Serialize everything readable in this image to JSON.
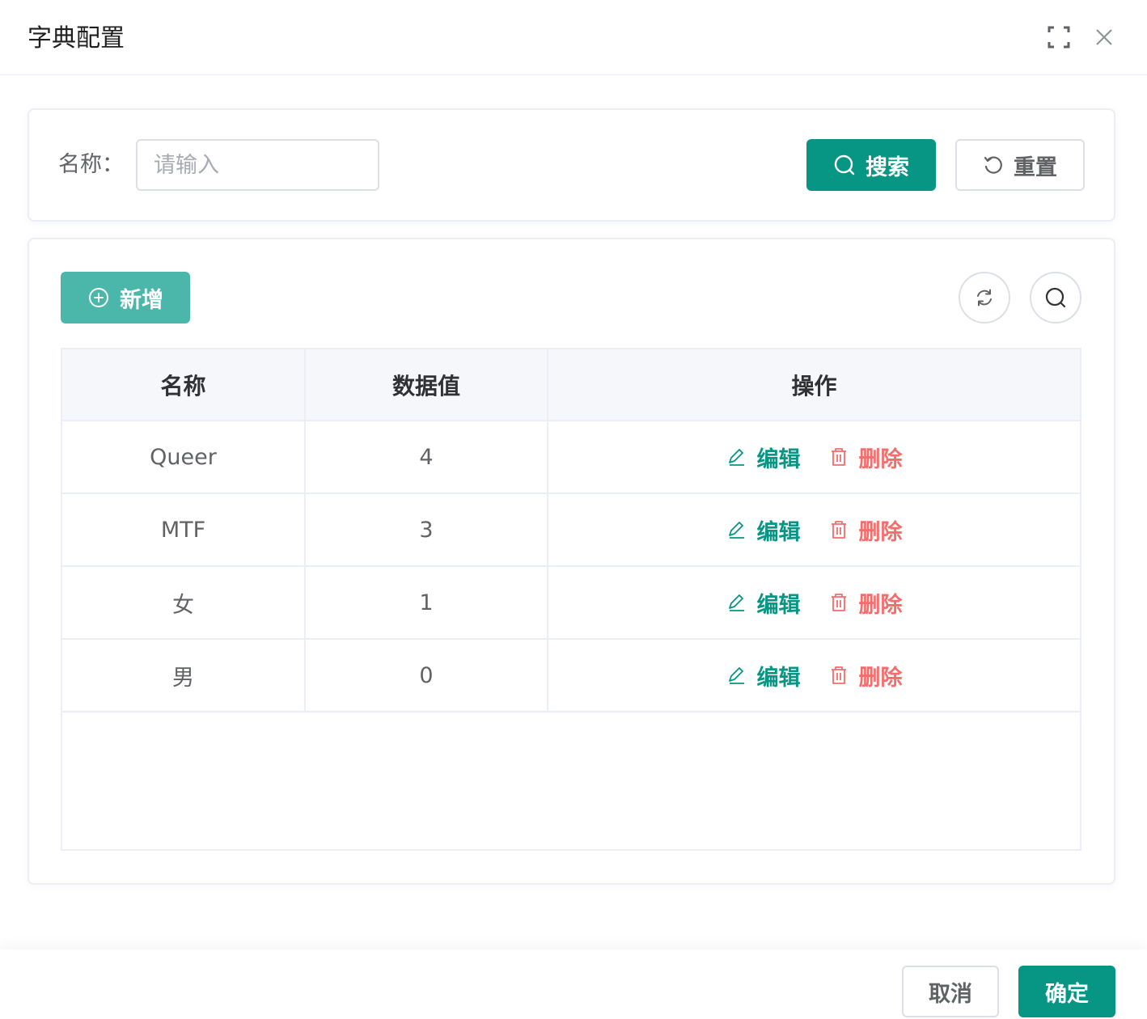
{
  "dialog": {
    "title": "字典配置"
  },
  "search": {
    "label": "名称：",
    "placeholder": "请输入",
    "search_label": "搜索",
    "reset_label": "重置"
  },
  "toolbar": {
    "add_label": "新增"
  },
  "table": {
    "columns": [
      "名称",
      "数据值",
      "操作"
    ],
    "rows": [
      {
        "name": "Queer",
        "value": "4",
        "edit": "编辑",
        "delete": "删除"
      },
      {
        "name": "MTF",
        "value": "3",
        "edit": "编辑",
        "delete": "删除"
      },
      {
        "name": "女",
        "value": "1",
        "edit": "编辑",
        "delete": "删除"
      },
      {
        "name": "男",
        "value": "0",
        "edit": "编辑",
        "delete": "删除"
      }
    ]
  },
  "footer": {
    "cancel_label": "取消",
    "confirm_label": "确定"
  },
  "colors": {
    "primary": "#079584",
    "primary_light": "#4bb7aa",
    "danger": "#f56c6c"
  },
  "icons": [
    "fullscreen-icon",
    "close-icon",
    "search-icon",
    "reset-icon",
    "plus-circle-icon",
    "refresh-icon",
    "edit-icon",
    "trash-icon"
  ]
}
